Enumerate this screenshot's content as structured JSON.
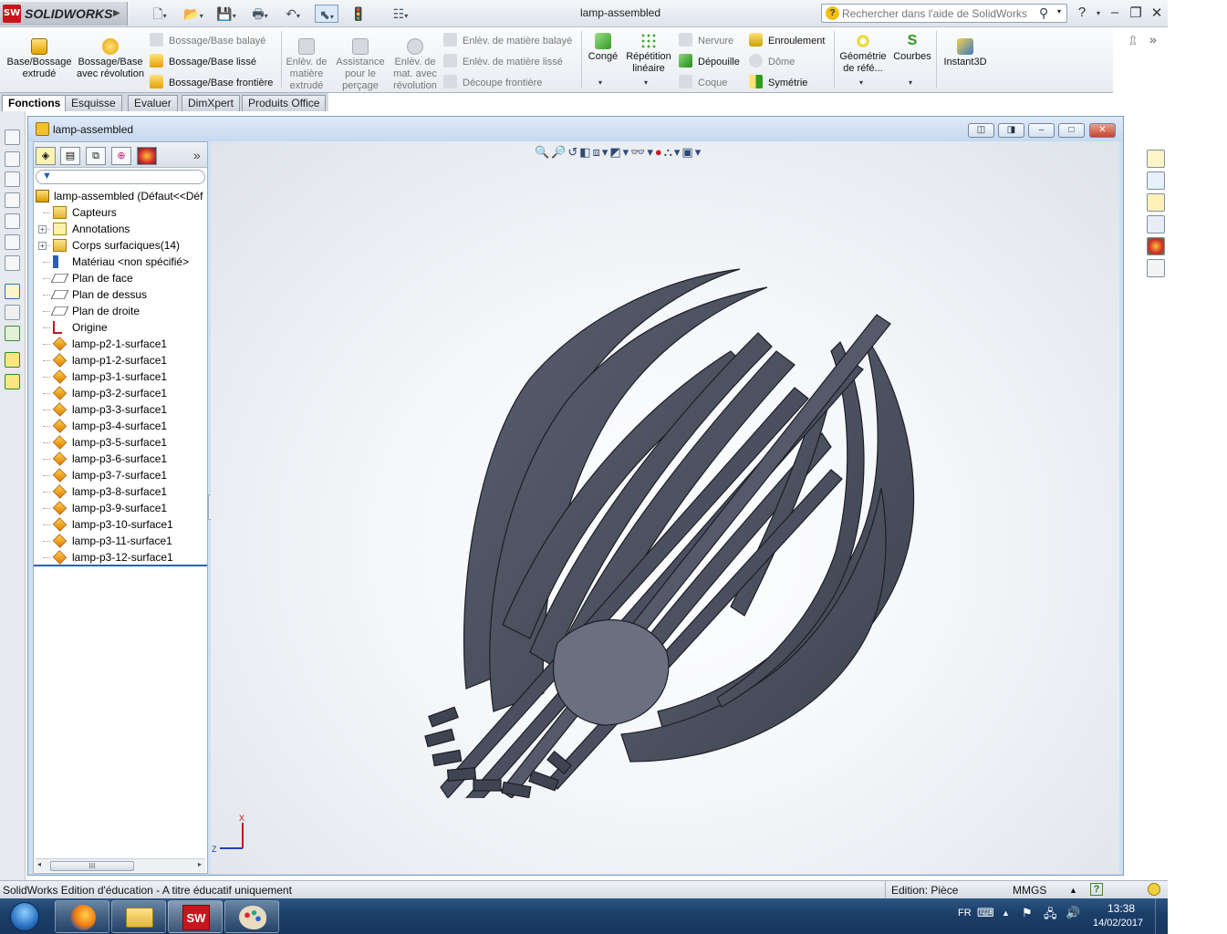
{
  "app": {
    "name": "SOLIDWORKS",
    "badge": "SW",
    "title": "lamp-assembled"
  },
  "help_search": {
    "placeholder": "Rechercher dans l'aide de SolidWorks"
  },
  "commands": {
    "base_extrude": "Base/Bossage extrudé",
    "base_revolve": "Bossage/Base avec révolution",
    "swept_boss": "Bossage/Base balayé",
    "lofted_boss": "Bossage/Base lissé",
    "boundary_boss": "Bossage/Base frontière",
    "extruded_cut": "Enlèv. de matière extrudé",
    "hole_wizard": "Assistance pour le perçage",
    "revolved_cut": "Enlèv. de mat. avec révolution",
    "swept_cut": "Enlèv. de matière balayé",
    "lofted_cut": "Enlèv. de matière lissé",
    "boundary_cut": "Découpe frontière",
    "fillet": "Congé",
    "linear_pattern": "Répétition linéaire",
    "rib": "Nervure",
    "draft": "Dépouille",
    "shell": "Coque",
    "wrap": "Enroulement",
    "dome": "Dôme",
    "mirror": "Symétrie",
    "ref_geometry": "Géométrie de réfé...",
    "curves": "Courbes",
    "instant3d": "Instant3D"
  },
  "tabs": [
    "Fonctions",
    "Esquisse",
    "Evaluer",
    "DimXpert",
    "Produits Office"
  ],
  "document": {
    "title": "lamp-assembled"
  },
  "tree": {
    "root": "lamp-assembled  (Défaut<<Déf",
    "items": [
      {
        "label": "Capteurs",
        "icon": "sensor-folder-icon"
      },
      {
        "label": "Annotations",
        "icon": "annotations-icon",
        "expand": "+"
      },
      {
        "label": "Corps surfaciques(14)",
        "icon": "surface-bodies-folder-icon",
        "expand": "+"
      },
      {
        "label": "Matériau <non spécifié>",
        "icon": "material-icon"
      },
      {
        "label": "Plan de face",
        "icon": "plane-icon"
      },
      {
        "label": "Plan de dessus",
        "icon": "plane-icon"
      },
      {
        "label": "Plan de droite",
        "icon": "plane-icon"
      },
      {
        "label": "Origine",
        "icon": "origin-icon"
      },
      {
        "label": "lamp-p2-1-surface1",
        "icon": "surface-feature-icon"
      },
      {
        "label": "lamp-p1-2-surface1",
        "icon": "surface-feature-icon"
      },
      {
        "label": "lamp-p3-1-surface1",
        "icon": "surface-feature-icon"
      },
      {
        "label": "lamp-p3-2-surface1",
        "icon": "surface-feature-icon"
      },
      {
        "label": "lamp-p3-3-surface1",
        "icon": "surface-feature-icon"
      },
      {
        "label": "lamp-p3-4-surface1",
        "icon": "surface-feature-icon"
      },
      {
        "label": "lamp-p3-5-surface1",
        "icon": "surface-feature-icon"
      },
      {
        "label": "lamp-p3-6-surface1",
        "icon": "surface-feature-icon"
      },
      {
        "label": "lamp-p3-7-surface1",
        "icon": "surface-feature-icon"
      },
      {
        "label": "lamp-p3-8-surface1",
        "icon": "surface-feature-icon"
      },
      {
        "label": "lamp-p3-9-surface1",
        "icon": "surface-feature-icon"
      },
      {
        "label": "lamp-p3-10-surface1",
        "icon": "surface-feature-icon"
      },
      {
        "label": "lamp-p3-11-surface1",
        "icon": "surface-feature-icon"
      },
      {
        "label": "lamp-p3-12-surface1",
        "icon": "surface-feature-icon"
      }
    ]
  },
  "fm_scroll_label": "III",
  "triad": {
    "x_label": "X",
    "z_label": "Z"
  },
  "status": {
    "left": "SolidWorks Edition d'éducation - A titre éducatif uniquement",
    "mode": "Edition: Pièce",
    "units": "MMGS",
    "help": "?"
  },
  "taskbar": {
    "lang": "FR",
    "time": "13:38",
    "date": "14/02/2017"
  },
  "colors": {
    "model": "#4a4f5e",
    "model_light": "#6f7587",
    "accent": "#c8161d"
  }
}
